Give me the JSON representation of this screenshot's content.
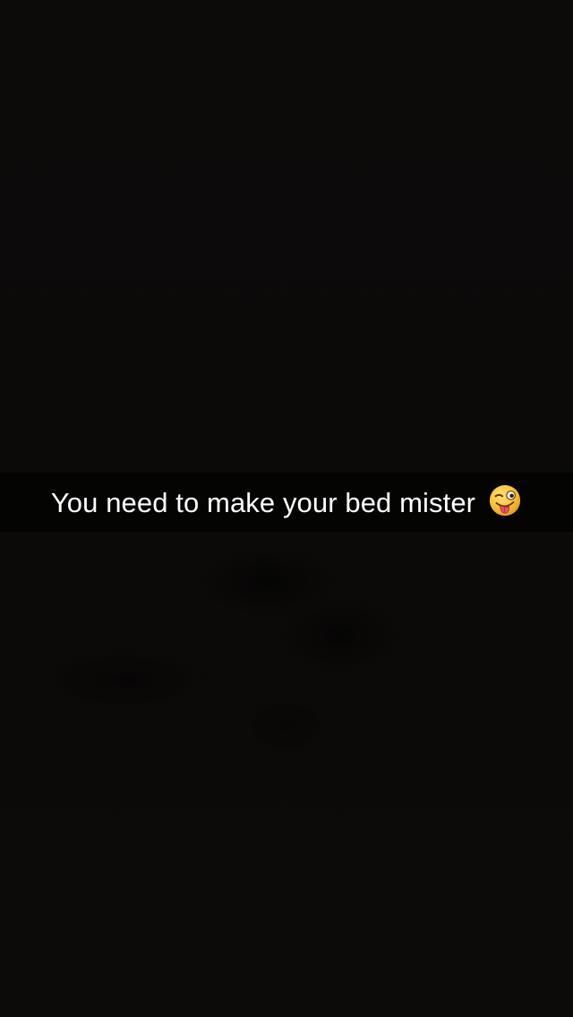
{
  "snap": {
    "caption": {
      "text": "You need to make your bed mister",
      "emoji": "winking-face-with-tongue-icon"
    }
  },
  "colors": {
    "background": "#0b0a09",
    "caption_bar": "rgba(0,0,0,0.6)",
    "caption_text": "#ffffff",
    "emoji_face": "#f7c13a"
  }
}
